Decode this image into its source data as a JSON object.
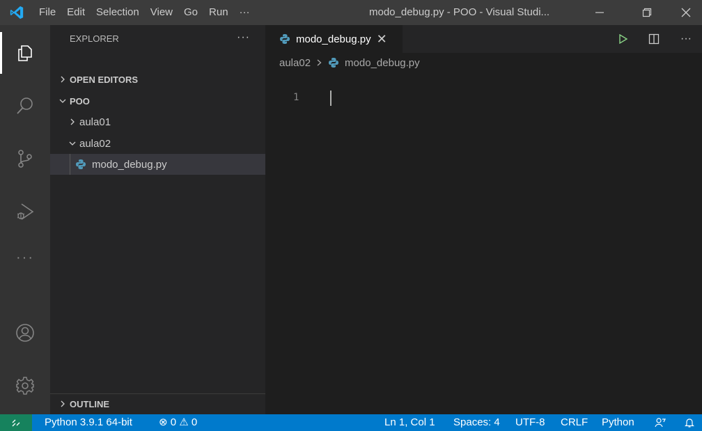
{
  "titlebar": {
    "menu": [
      "File",
      "Edit",
      "Selection",
      "View",
      "Go",
      "Run",
      "···"
    ],
    "window_title": "modo_debug.py - POO - Visual Studi..."
  },
  "activitybar": {
    "items": [
      "explorer-icon",
      "search-icon",
      "source-control-icon",
      "run-debug-icon",
      "more-icon",
      "accounts-icon",
      "settings-gear-icon"
    ],
    "more_label": "···"
  },
  "sidebar": {
    "title": "EXPLORER",
    "more": "···",
    "open_editors": "OPEN EDITORS",
    "workspace": "POO",
    "folders": [
      "aula01",
      "aula02"
    ],
    "file": "modo_debug.py",
    "outline": "OUTLINE"
  },
  "editor": {
    "tab_label": "modo_debug.py",
    "tab_close": "✕",
    "breadcrumb_folder": "aula02",
    "breadcrumb_file": "modo_debug.py",
    "line_number": "1"
  },
  "statusbar": {
    "interpreter": "Python 3.9.1 64-bit",
    "problems": "⊗ 0 ⚠ 0",
    "position": "Ln 1, Col 1",
    "spaces": "Spaces: 4",
    "encoding": "UTF-8",
    "eol": "CRLF",
    "language": "Python"
  },
  "colors": {
    "accent": "#007acc",
    "remote": "#16825d",
    "titlebar": "#3c3c3c",
    "activitybar": "#333333",
    "sidebar": "#252526",
    "editor": "#1e1e1e"
  }
}
